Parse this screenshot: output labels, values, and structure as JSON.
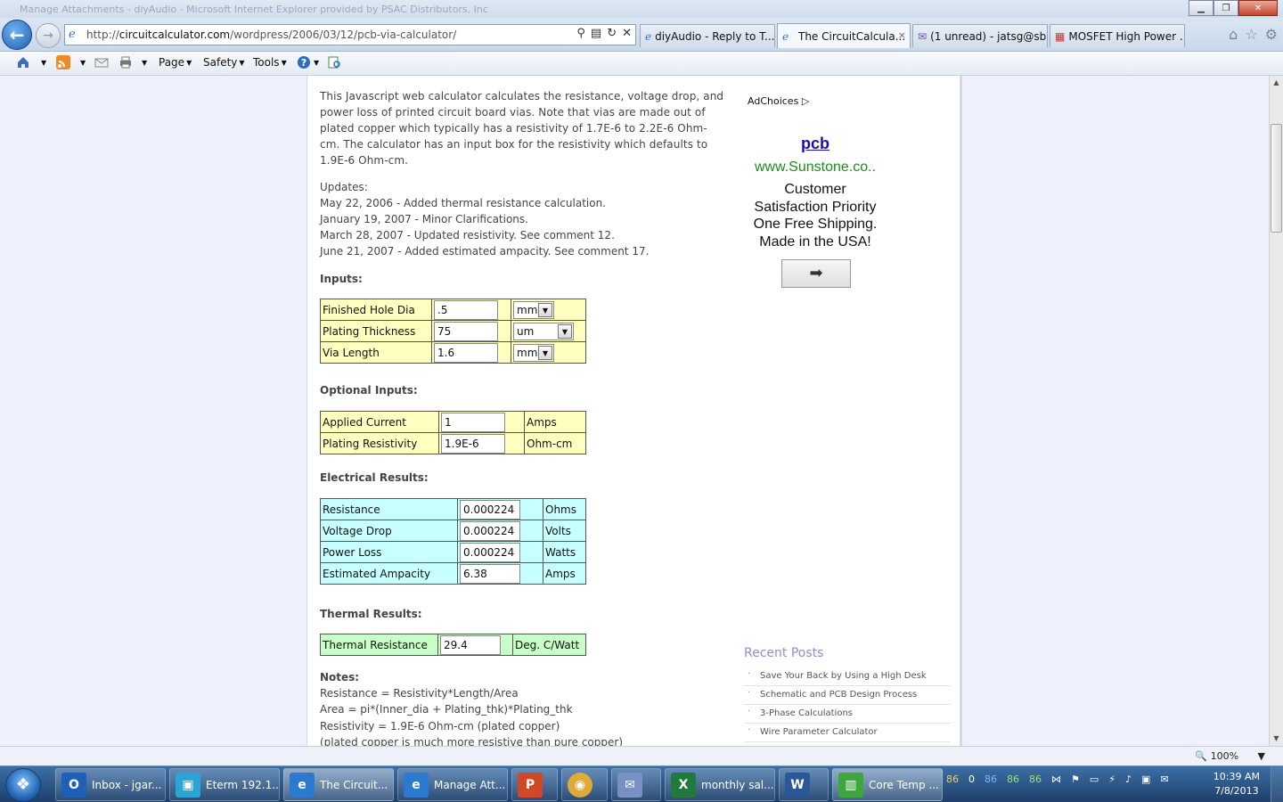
{
  "window": {
    "title": "Manage Attachments - diyAudio - Microsoft Internet Explorer provided by PSAC Distributors, Inc"
  },
  "address_bar": {
    "url_prefix": "http://",
    "url_domain": "circuitcalculator.com",
    "url_path": "/wordpress/2006/03/12/pcb-via-calculator/"
  },
  "tabs": [
    {
      "label": "diyAudio - Reply to T..."
    },
    {
      "label": "The CircuitCalcula...",
      "close": "×"
    },
    {
      "label": "(1 unread) - jatsg@sb..."
    },
    {
      "label": "MOSFET High Power ..."
    }
  ],
  "command_bar": {
    "page_label": "Page",
    "safety_label": "Safety",
    "tools_label": "Tools"
  },
  "page": {
    "intro": "This Javascript web calculator calculates the resistance, voltage drop, and power loss of printed circuit board vias. Note that vias are made out of plated copper which typically has a resistivity of 1.7E-6 to 2.2E-6 Ohm-cm. The calculator has an input box for the resistivity which defaults to 1.9E-6 Ohm-cm.",
    "updates_heading": "Updates:",
    "updates": [
      "May 22, 2006 - Added thermal resistance calculation.",
      "January 19, 2007 - Minor Clarifications.",
      "March 28, 2007 - Updated resistivity. See comment 12.",
      "June 21, 2007 - Added estimated ampacity. See comment 17."
    ],
    "inputs_heading": "Inputs:",
    "inputs": [
      {
        "label": "Finished Hole Dia",
        "value": ".5",
        "unit": "mm"
      },
      {
        "label": "Plating Thickness",
        "value": "75",
        "unit": "um"
      },
      {
        "label": "Via Length",
        "value": "1.6",
        "unit": "mm"
      }
    ],
    "optional_heading": "Optional Inputs:",
    "optional_inputs": [
      {
        "label": "Applied Current",
        "value": "1",
        "unit": "Amps"
      },
      {
        "label": "Plating Resistivity",
        "value": "1.9E-6",
        "unit": "Ohm-cm"
      }
    ],
    "electrical_heading": "Electrical Results:",
    "electrical_results": [
      {
        "label": "Resistance",
        "value": "0.000224",
        "unit": "Ohms"
      },
      {
        "label": "Voltage Drop",
        "value": "0.000224",
        "unit": "Volts"
      },
      {
        "label": "Power Loss",
        "value": "0.000224",
        "unit": "Watts"
      },
      {
        "label": "Estimated Ampacity",
        "value": "6.38",
        "unit": "Amps"
      }
    ],
    "thermal_heading": "Thermal Results:",
    "thermal_results": [
      {
        "label": "Thermal Resistance",
        "value": "29.4",
        "unit": "Deg. C/Watt"
      }
    ],
    "notes_heading": "Notes:",
    "notes": [
      "Resistance = Resistivity*Length/Area",
      "Area = pi*(Inner_dia + Plating_thk)*Plating_thk",
      "Resistivity = 1.9E-6 Ohm-cm (plated copper)",
      "(plated copper is much more resistive than pure copper)"
    ]
  },
  "ad": {
    "adchoices": "AdChoices",
    "link": "pcb",
    "url": "www.Sunstone.co..",
    "copy": [
      "Customer",
      "Satisfaction Priority",
      "One Free Shipping.",
      "Made in the USA!"
    ]
  },
  "recent_posts": {
    "title": "Recent Posts",
    "items": [
      "Save Your Back by Using a High Desk",
      "Schematic and PCB Design Process",
      "3-Phase Calculations",
      "Wire Parameter Calculator"
    ]
  },
  "status_bar": {
    "zoom": "100%"
  },
  "taskbar": {
    "items": [
      {
        "label": "Inbox - jgar...",
        "icon": "O",
        "color": "#1f5fb8"
      },
      {
        "label": "Eterm 192.1...",
        "icon": "▣",
        "color": "#2aa5d6"
      },
      {
        "label": "The Circuit...",
        "icon": "e",
        "color": "#2b79d1"
      },
      {
        "label": "Manage Att...",
        "icon": "e",
        "color": "#2b79d1"
      },
      {
        "label": "",
        "icon": "P",
        "color": "#d24726"
      },
      {
        "label": "",
        "icon": "◉",
        "color": "#e0a93b"
      },
      {
        "label": "",
        "icon": "✉",
        "color": "#7a8fc4"
      },
      {
        "label": "monthly sal...",
        "icon": "X",
        "color": "#1f7a3c"
      },
      {
        "label": "",
        "icon": "W",
        "color": "#2b5797"
      },
      {
        "label": "Core Temp ...",
        "icon": "▥",
        "color": "#3ca83c"
      }
    ],
    "tray_temps": [
      "86",
      "0",
      "86",
      "86",
      "86"
    ],
    "clock_time": "10:39 AM",
    "clock_date": "7/8/2013"
  }
}
